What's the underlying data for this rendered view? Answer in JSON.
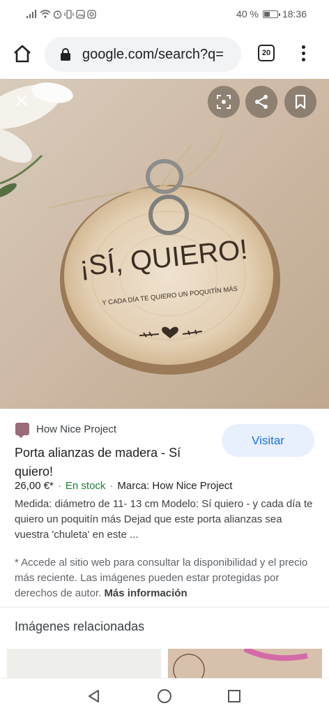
{
  "status_bar": {
    "battery_text": "40 %",
    "time": "18:36"
  },
  "browser": {
    "url": "google.com/search?q=",
    "tab_count": "20"
  },
  "hero_image": {
    "headline": "¡SÍ, QUIERO!",
    "subline": "Y CADA DÍA TE QUIERO UN POQUITÍN MÁS"
  },
  "result": {
    "source": "How Nice Project",
    "visit_label": "Visitar",
    "title": "Porta alianzas de madera - Sí quiero!",
    "price": "26,00 €*",
    "stock": "En stock",
    "brand": "Marca: How Nice Project",
    "description": "Medida: diámetro de 11- 13 cm Modelo: Sí quiero - y cada día te quiero un poquitín más Dejad que este porta alianzas sea vuestra 'chuleta' en este ..."
  },
  "disclaimer": {
    "text": "* Accede al sitio web para consultar la disponibilidad y el precio más reciente. Las imágenes pueden estar protegidas por derechos de autor.",
    "more_link": "Más información"
  },
  "related": {
    "title": "Imágenes relacionadas"
  },
  "colors": {
    "accent": "#1a73e8",
    "stock_green": "#188038",
    "pill_bg": "#f1f3f4"
  }
}
